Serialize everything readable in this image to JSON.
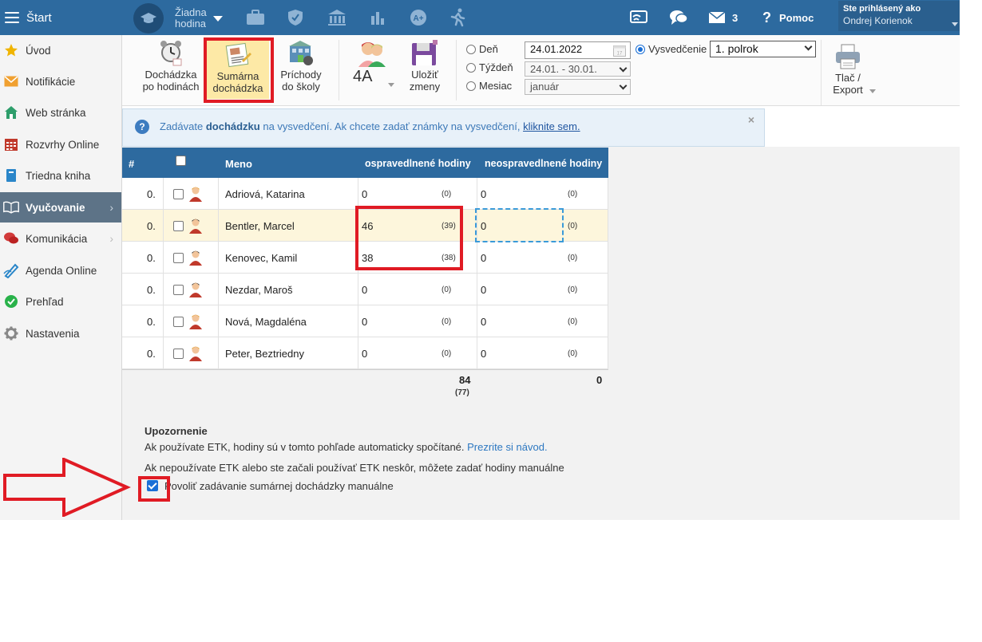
{
  "topbar": {
    "start_label": "Štart",
    "lesson_label": "Žiadna hodina",
    "message_count": "3",
    "help_label": "Pomoc",
    "user_caption": "Ste prihlásený ako",
    "user_name": "Ondrej Korienok",
    "icons": [
      "briefcase-icon",
      "shield-icon",
      "bank-icon",
      "chart-icon",
      "grade-icon",
      "running-icon",
      "cast-icon",
      "chat-icon",
      "mail-icon",
      "help-icon"
    ]
  },
  "sidebar": {
    "items": [
      {
        "label": "Úvod",
        "icon": "star-icon",
        "color": "#f0b400"
      },
      {
        "label": "Notifikácie",
        "icon": "envelope-icon",
        "color": "#f0a030"
      },
      {
        "label": "Web stránka",
        "icon": "home-icon",
        "color": "#2e9e6b"
      },
      {
        "label": "Rozvrhy Online",
        "icon": "calendar-icon",
        "color": "#c0392b"
      },
      {
        "label": "Triedna kniha",
        "icon": "book-icon",
        "color": "#2a86c9"
      },
      {
        "label": "Vyučovanie",
        "icon": "open-book-icon",
        "color": "#ffffff"
      },
      {
        "label": "Komunikácia",
        "icon": "chat-bubbles-icon",
        "color": "#d23b3b"
      },
      {
        "label": "Agenda Online",
        "icon": "pen-icon",
        "color": "#2a86c9"
      },
      {
        "label": "Prehľad",
        "icon": "check-circle-icon",
        "color": "#29b24a"
      },
      {
        "label": "Nastavenia",
        "icon": "gear-icon",
        "color": "#888888"
      }
    ]
  },
  "toolbar": {
    "dochadzka_line1": "Dochádzka",
    "dochadzka_line2": "po hodinách",
    "sumarna_line1": "Sumárna",
    "sumarna_line2": "dochádzka",
    "prichody_line1": "Príchody",
    "prichody_line2": "do školy",
    "class_label": "4A",
    "ulozit_line1": "Uložiť",
    "ulozit_line2": "zmeny",
    "radio_den": "Deň",
    "radio_tyzden": "Týždeň",
    "radio_mesiac": "Mesiac",
    "date_value": "24.01.2022",
    "week_value": "24.01. - 30.01.",
    "month_value": "január",
    "radio_vysvedcenie": "Vysvedčenie",
    "term_value": "1. polrok",
    "print_line1": "Tlač /",
    "print_line2": "Export"
  },
  "notice": {
    "prefix": "Zadávate ",
    "bold": "dochádzku",
    "middle": " na vysvedčení. Ak chcete zadať známky na vysvedčení, ",
    "link": "kliknite sem."
  },
  "table": {
    "headers": {
      "num": "#",
      "meno": "Meno",
      "excused": "ospravedlnené hodiny",
      "unexcused": "neospravedlnené hodiny"
    },
    "rows": [
      {
        "num": "0.",
        "name": "Adriová, Katarina",
        "excused": "0",
        "excused_auto": "(0)",
        "unexcused": "0",
        "unexcused_auto": "(0)",
        "gender": "female"
      },
      {
        "num": "0.",
        "name": "Bentler, Marcel",
        "excused": "46",
        "excused_auto": "(39)",
        "unexcused": "0",
        "unexcused_auto": "(0)",
        "gender": "male"
      },
      {
        "num": "0.",
        "name": "Kenovec, Kamil",
        "excused": "38",
        "excused_auto": "(38)",
        "unexcused": "0",
        "unexcused_auto": "(0)",
        "gender": "male"
      },
      {
        "num": "0.",
        "name": "Nezdar, Maroš",
        "excused": "0",
        "excused_auto": "(0)",
        "unexcused": "0",
        "unexcused_auto": "(0)",
        "gender": "male"
      },
      {
        "num": "0.",
        "name": "Nová, Magdaléna",
        "excused": "0",
        "excused_auto": "(0)",
        "unexcused": "0",
        "unexcused_auto": "(0)",
        "gender": "female"
      },
      {
        "num": "0.",
        "name": "Peter, Beztriedny",
        "excused": "0",
        "excused_auto": "(0)",
        "unexcused": "0",
        "unexcused_auto": "(0)",
        "gender": "female"
      }
    ],
    "totals": {
      "excused": "84",
      "excused_auto": "(77)",
      "unexcused": "0"
    }
  },
  "warning": {
    "title": "Upozornenie",
    "line1": "Ak používate ETK, hodiny sú v tomto pohľade automaticky spočítané. ",
    "line1_link": "Prezrite si návod.",
    "line2": "Ak nepoužívate ETK alebo ste začali používať ETK neskôr, môžete zadať hodiny manuálne",
    "checkbox_label": "Povoliť zadávanie sumárnej dochádzky manuálne"
  },
  "colors": {
    "accent": "#2d6a9f",
    "highlight": "#e01b24",
    "annotation": "#e01b24"
  }
}
